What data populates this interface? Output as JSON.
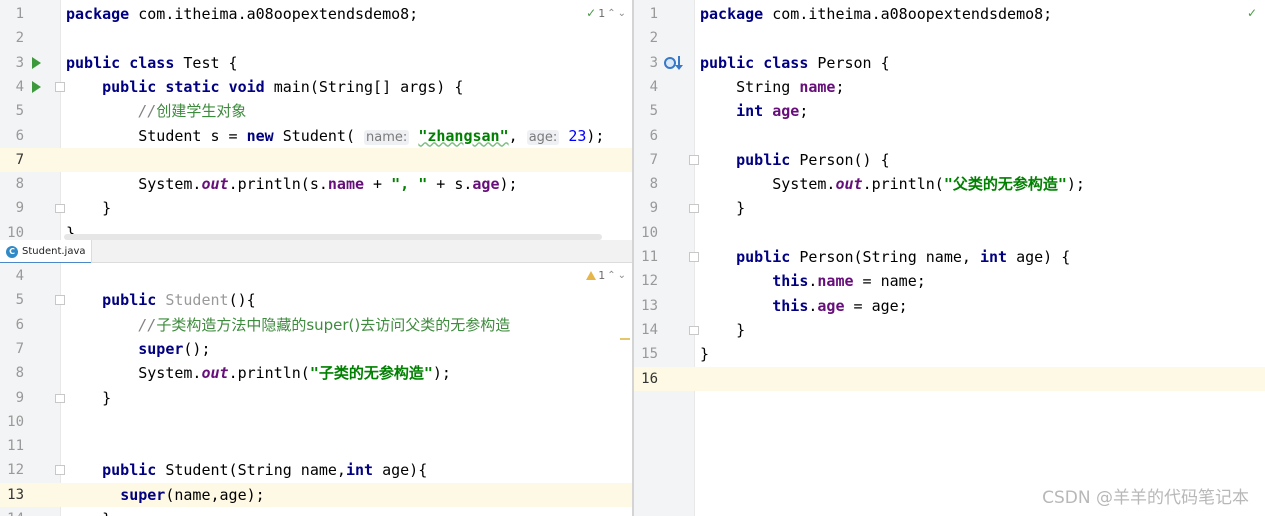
{
  "test_editor": {
    "inspection_count": "1",
    "lines": [
      {
        "n": "1",
        "tokens": [
          {
            "t": "package",
            "c": "kw"
          },
          {
            "t": " com.itheima.a08oopextendsdemo8;"
          }
        ]
      },
      {
        "n": "2",
        "tokens": []
      },
      {
        "n": "3",
        "run": true,
        "tokens": [
          {
            "t": "public",
            "c": "kw"
          },
          {
            "t": " "
          },
          {
            "t": "class",
            "c": "kw"
          },
          {
            "t": " Test {"
          }
        ]
      },
      {
        "n": "4",
        "run": true,
        "fold": true,
        "tokens": [
          {
            "t": "    "
          },
          {
            "t": "public",
            "c": "kw"
          },
          {
            "t": " "
          },
          {
            "t": "static",
            "c": "kw"
          },
          {
            "t": " "
          },
          {
            "t": "void",
            "c": "kw"
          },
          {
            "t": " main(String[] args) {"
          }
        ]
      },
      {
        "n": "5",
        "tokens": [
          {
            "t": "        "
          },
          {
            "t": "//",
            "c": "cmt"
          },
          {
            "t": "创建学生对象",
            "c": "cmtcn"
          }
        ]
      },
      {
        "n": "6",
        "tokens": [
          {
            "t": "        Student s = "
          },
          {
            "t": "new",
            "c": "kw"
          },
          {
            "t": " Student( "
          },
          {
            "t": "name:",
            "c": "hint"
          },
          {
            "t": " "
          },
          {
            "t": "\"zhangsan\"",
            "c": "strund"
          },
          {
            "t": ", "
          },
          {
            "t": "age:",
            "c": "hint"
          },
          {
            "t": " "
          },
          {
            "t": "23",
            "c": "num"
          },
          {
            "t": ");"
          }
        ]
      },
      {
        "n": "7",
        "hl": true,
        "tokens": []
      },
      {
        "n": "8",
        "tokens": [
          {
            "t": "        System."
          },
          {
            "t": "out",
            "c": "sfld"
          },
          {
            "t": ".println(s."
          },
          {
            "t": "name",
            "c": "fld"
          },
          {
            "t": " + "
          },
          {
            "t": "\", \"",
            "c": "str"
          },
          {
            "t": " + s."
          },
          {
            "t": "age",
            "c": "fld"
          },
          {
            "t": ");"
          }
        ]
      },
      {
        "n": "9",
        "foldEnd": true,
        "tokens": [
          {
            "t": "    }"
          }
        ]
      },
      {
        "n": "10",
        "tokens": [
          {
            "t": "}"
          }
        ]
      }
    ]
  },
  "student_tab": {
    "label": "Student.java",
    "class_glyph": "C"
  },
  "student_editor": {
    "inspection_count": "1",
    "lines": [
      {
        "n": "4",
        "tokens": []
      },
      {
        "n": "5",
        "fold": true,
        "tokens": [
          {
            "t": "    "
          },
          {
            "t": "public",
            "c": "kw"
          },
          {
            "t": " "
          },
          {
            "t": "Student",
            "c": "gray"
          },
          {
            "t": "(){"
          }
        ]
      },
      {
        "n": "6",
        "tokens": [
          {
            "t": "        "
          },
          {
            "t": "//",
            "c": "cmt"
          },
          {
            "t": "子类构造方法中隐藏的super()去访问父类的无参构造",
            "c": "cmtcn"
          }
        ]
      },
      {
        "n": "7",
        "tokens": [
          {
            "t": "        "
          },
          {
            "t": "super",
            "c": "kw"
          },
          {
            "t": "();"
          }
        ]
      },
      {
        "n": "8",
        "tokens": [
          {
            "t": "        System."
          },
          {
            "t": "out",
            "c": "sfld"
          },
          {
            "t": ".println("
          },
          {
            "t": "\"子类的无参构造\"",
            "c": "str"
          },
          {
            "t": ");"
          }
        ]
      },
      {
        "n": "9",
        "foldEnd": true,
        "tokens": [
          {
            "t": "    }"
          }
        ]
      },
      {
        "n": "10",
        "tokens": []
      },
      {
        "n": "11",
        "tokens": []
      },
      {
        "n": "12",
        "fold": true,
        "tokens": [
          {
            "t": "    "
          },
          {
            "t": "public",
            "c": "kw"
          },
          {
            "t": " Student(String name,"
          },
          {
            "t": "int",
            "c": "kw"
          },
          {
            "t": " age){"
          }
        ]
      },
      {
        "n": "13",
        "hl": true,
        "tokens": [
          {
            "t": "      "
          },
          {
            "t": "super",
            "c": "kw"
          },
          {
            "t": "(name,age);"
          }
        ]
      },
      {
        "n": "14",
        "tokens": [
          {
            "t": "    }"
          }
        ]
      }
    ]
  },
  "person_editor": {
    "lines": [
      {
        "n": "1",
        "tokens": [
          {
            "t": "package",
            "c": "kw"
          },
          {
            "t": " com.itheima.a08oopextendsdemo8;"
          }
        ]
      },
      {
        "n": "2",
        "tokens": []
      },
      {
        "n": "3",
        "override": true,
        "tokens": [
          {
            "t": "public",
            "c": "kw"
          },
          {
            "t": " "
          },
          {
            "t": "class",
            "c": "kw"
          },
          {
            "t": " Person {"
          }
        ]
      },
      {
        "n": "4",
        "tokens": [
          {
            "t": "    String "
          },
          {
            "t": "name",
            "c": "fld"
          },
          {
            "t": ";"
          }
        ]
      },
      {
        "n": "5",
        "tokens": [
          {
            "t": "    "
          },
          {
            "t": "int",
            "c": "kw"
          },
          {
            "t": " "
          },
          {
            "t": "age",
            "c": "fld"
          },
          {
            "t": ";"
          }
        ]
      },
      {
        "n": "6",
        "tokens": []
      },
      {
        "n": "7",
        "fold": true,
        "tokens": [
          {
            "t": "    "
          },
          {
            "t": "public",
            "c": "kw"
          },
          {
            "t": " Person() {"
          }
        ]
      },
      {
        "n": "8",
        "tokens": [
          {
            "t": "        System."
          },
          {
            "t": "out",
            "c": "sfld"
          },
          {
            "t": ".println("
          },
          {
            "t": "\"父类的无参构造\"",
            "c": "str"
          },
          {
            "t": ");"
          }
        ]
      },
      {
        "n": "9",
        "foldEnd": true,
        "tokens": [
          {
            "t": "    }"
          }
        ]
      },
      {
        "n": "10",
        "tokens": []
      },
      {
        "n": "11",
        "fold": true,
        "tokens": [
          {
            "t": "    "
          },
          {
            "t": "public",
            "c": "kw"
          },
          {
            "t": " Person(String name, "
          },
          {
            "t": "int",
            "c": "kw"
          },
          {
            "t": " age) {"
          }
        ]
      },
      {
        "n": "12",
        "tokens": [
          {
            "t": "        "
          },
          {
            "t": "this",
            "c": "kw"
          },
          {
            "t": "."
          },
          {
            "t": "name",
            "c": "fld"
          },
          {
            "t": " = name;"
          }
        ]
      },
      {
        "n": "13",
        "tokens": [
          {
            "t": "        "
          },
          {
            "t": "this",
            "c": "kw"
          },
          {
            "t": "."
          },
          {
            "t": "age",
            "c": "fld"
          },
          {
            "t": " = age;"
          }
        ]
      },
      {
        "n": "14",
        "foldEnd": true,
        "tokens": [
          {
            "t": "    }"
          }
        ]
      },
      {
        "n": "15",
        "tokens": [
          {
            "t": "}"
          }
        ]
      },
      {
        "n": "16",
        "hl": true,
        "tokens": []
      }
    ]
  },
  "watermark": "CSDN @羊羊的代码笔记本"
}
